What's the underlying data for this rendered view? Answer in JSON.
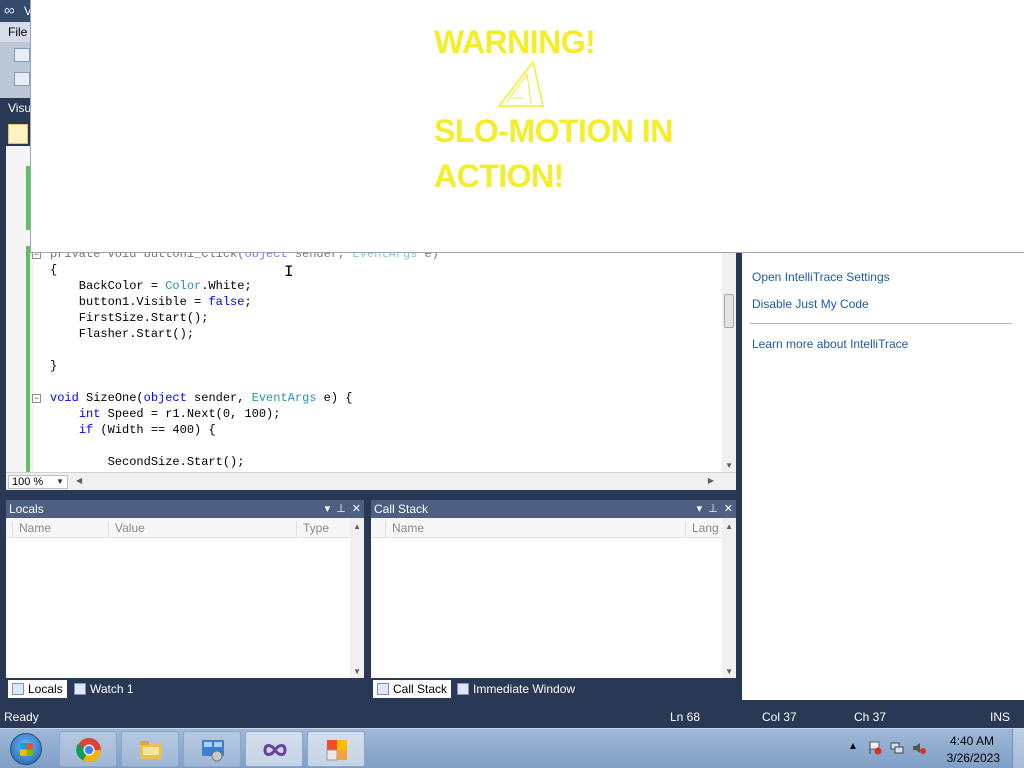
{
  "vs": {
    "title_partial": "V",
    "menu_file": "File",
    "doc_tab_partial": "Visu"
  },
  "editor": {
    "code_lines": [
      {
        "parts": [
          {
            "t": "private void button1_Click(",
            "c": "kw-partial"
          },
          {
            "t": "object",
            "c": "kw"
          },
          {
            "t": " sender, ",
            "c": ""
          },
          {
            "t": "EventArgs",
            "c": "ty"
          },
          {
            "t": " e)",
            "c": ""
          }
        ]
      },
      {
        "parts": [
          {
            "t": "{",
            "c": ""
          }
        ]
      },
      {
        "parts": [
          {
            "t": "    BackColor = ",
            "c": ""
          },
          {
            "t": "Color",
            "c": "ty"
          },
          {
            "t": ".White;",
            "c": ""
          }
        ]
      },
      {
        "parts": [
          {
            "t": "    button1.Visible = ",
            "c": ""
          },
          {
            "t": "false",
            "c": "kw"
          },
          {
            "t": ";",
            "c": ""
          }
        ]
      },
      {
        "parts": [
          {
            "t": "    FirstSize.Start();",
            "c": ""
          }
        ]
      },
      {
        "parts": [
          {
            "t": "    Flasher.Start();",
            "c": ""
          }
        ]
      },
      {
        "parts": [
          {
            "t": "",
            "c": ""
          }
        ]
      },
      {
        "parts": [
          {
            "t": "}",
            "c": ""
          }
        ]
      },
      {
        "parts": [
          {
            "t": "",
            "c": ""
          }
        ]
      },
      {
        "parts": [
          {
            "t": "void",
            "c": "kw"
          },
          {
            "t": " SizeOne(",
            "c": ""
          },
          {
            "t": "object",
            "c": "kw"
          },
          {
            "t": " sender, ",
            "c": ""
          },
          {
            "t": "EventArgs",
            "c": "ty"
          },
          {
            "t": " e) {",
            "c": ""
          }
        ]
      },
      {
        "parts": [
          {
            "t": "    ",
            "c": ""
          },
          {
            "t": "int",
            "c": "kw"
          },
          {
            "t": " Speed = r1.Next(0, 100);",
            "c": ""
          }
        ]
      },
      {
        "parts": [
          {
            "t": "    ",
            "c": ""
          },
          {
            "t": "if",
            "c": "kw"
          },
          {
            "t": " (Width == 400) {",
            "c": ""
          }
        ]
      },
      {
        "parts": [
          {
            "t": "",
            "c": ""
          }
        ]
      },
      {
        "parts": [
          {
            "t": "        SecondSize.Start();",
            "c": ""
          }
        ]
      }
    ],
    "zoom": "100 %"
  },
  "intellitrace": {
    "open_settings": "Open IntelliTrace Settings",
    "disable_jmc": "Disable Just My Code",
    "learn_more": "Learn more about IntelliTrace"
  },
  "locals": {
    "title": "Locals",
    "columns": [
      "Name",
      "Value",
      "Type"
    ],
    "tabs": [
      "Locals",
      "Watch 1"
    ]
  },
  "callstack": {
    "title": "Call Stack",
    "columns": [
      "Name",
      "Lang"
    ],
    "tabs": [
      "Call Stack",
      "Immediate Window"
    ]
  },
  "status": {
    "text": "Ready",
    "ln": "Ln 68",
    "col": "Col 37",
    "ch": "Ch 37",
    "ins": "INS"
  },
  "taskbar": {
    "time": "4:40 AM",
    "date": "3/26/2023"
  },
  "overlay": {
    "line1": "WARNING!",
    "line2": "SLO-MOTION IN",
    "line3": "ACTION!",
    "text_color": "#f4ee2a"
  }
}
